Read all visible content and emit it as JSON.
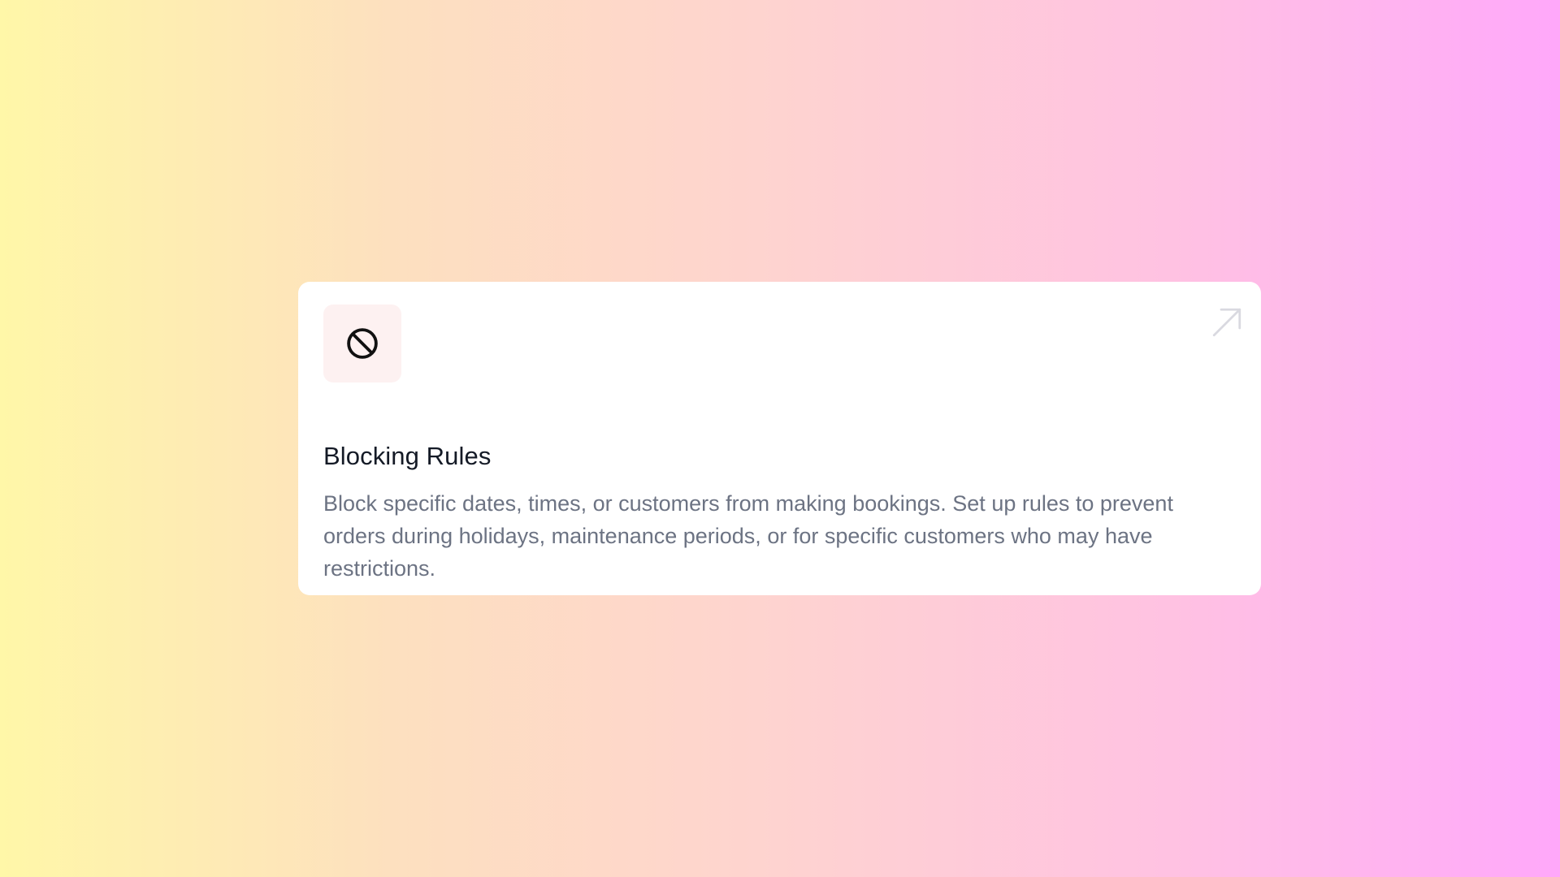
{
  "card": {
    "title": "Blocking Rules",
    "description": "Block specific dates, times, or customers from making bookings. Set up rules to prevent orders during holidays, maintenance periods, or for specific customers who may have restrictions.",
    "icon": "ban-icon",
    "link_icon": "arrow-up-right-icon"
  },
  "colors": {
    "gradient_start": "#fff7a8",
    "gradient_end": "#ffa8fa",
    "card_background": "#ffffff",
    "icon_tile_background": "#fdf1f1",
    "title": "#141a26",
    "description": "#6c7383",
    "link_icon": "#d9d9e0"
  }
}
